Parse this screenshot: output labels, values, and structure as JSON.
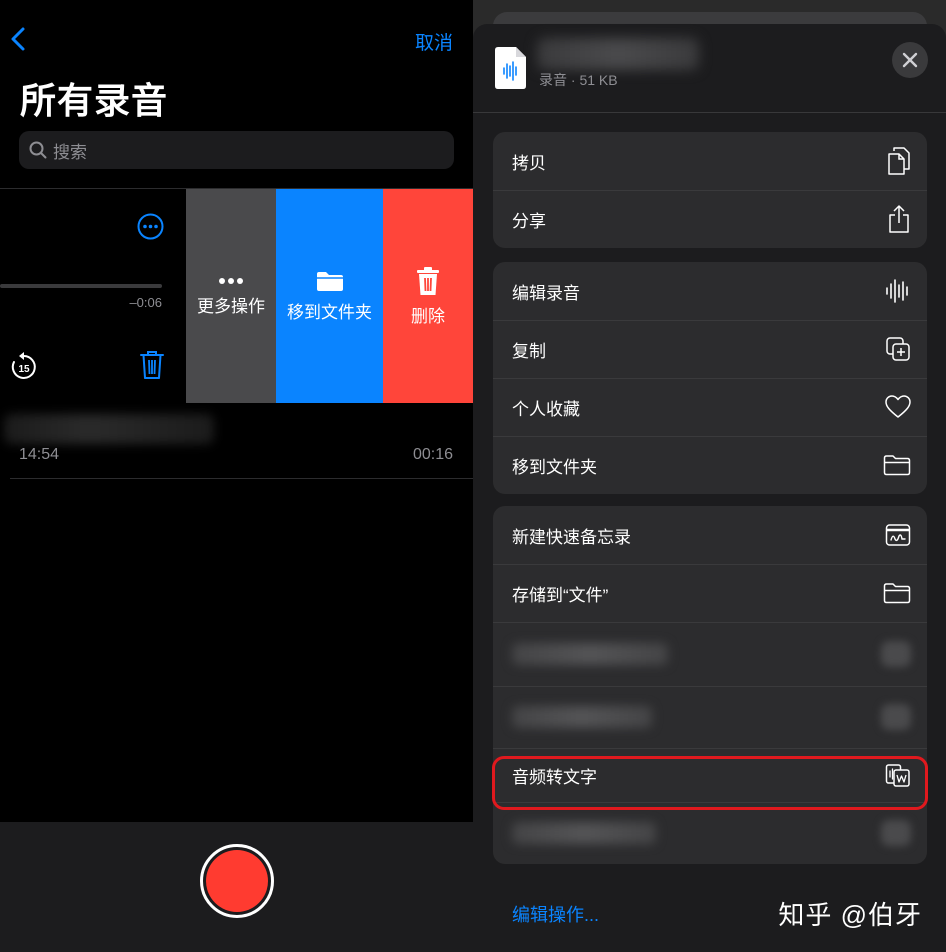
{
  "left": {
    "cancel_label": "取消",
    "title": "所有录音",
    "search_placeholder": "搜索",
    "current_recording": {
      "remaining_time": "–0:06",
      "skip_back_seconds": "15",
      "progress_fraction": 1.0
    },
    "swipe_actions": {
      "more": "更多操作",
      "move": "移到文件夹",
      "delete": "删除"
    },
    "second_recording": {
      "date": "14:54",
      "duration": "00:16"
    }
  },
  "sheet": {
    "file_meta": "录音 · 51 KB",
    "groups": [
      {
        "items": [
          {
            "label": "拷贝",
            "icon": "copy-icon"
          },
          {
            "label": "分享",
            "icon": "share-icon"
          }
        ]
      },
      {
        "items": [
          {
            "label": "编辑录音",
            "icon": "waveform-icon"
          },
          {
            "label": "复制",
            "icon": "duplicate-icon"
          },
          {
            "label": "个人收藏",
            "icon": "heart-icon"
          },
          {
            "label": "移到文件夹",
            "icon": "folder-icon"
          }
        ]
      },
      {
        "items": [
          {
            "label": "新建快速备忘录",
            "icon": "quick-note-icon"
          },
          {
            "label": "存储到“文件”",
            "icon": "folder-icon"
          },
          {
            "label": "",
            "icon": "blurred-icon"
          },
          {
            "label": "",
            "icon": "blurred-icon"
          },
          {
            "label": "音频转文字",
            "icon": "transcribe-icon"
          },
          {
            "label": "",
            "icon": "blurred-icon"
          }
        ]
      }
    ],
    "edit_actions_label": "编辑操作...",
    "watermark": "知乎 @伯牙"
  },
  "colors": {
    "accent": "#0a84ff",
    "delete": "#ff453a",
    "record": "#ff3b30",
    "highlight": "#e0191e"
  }
}
